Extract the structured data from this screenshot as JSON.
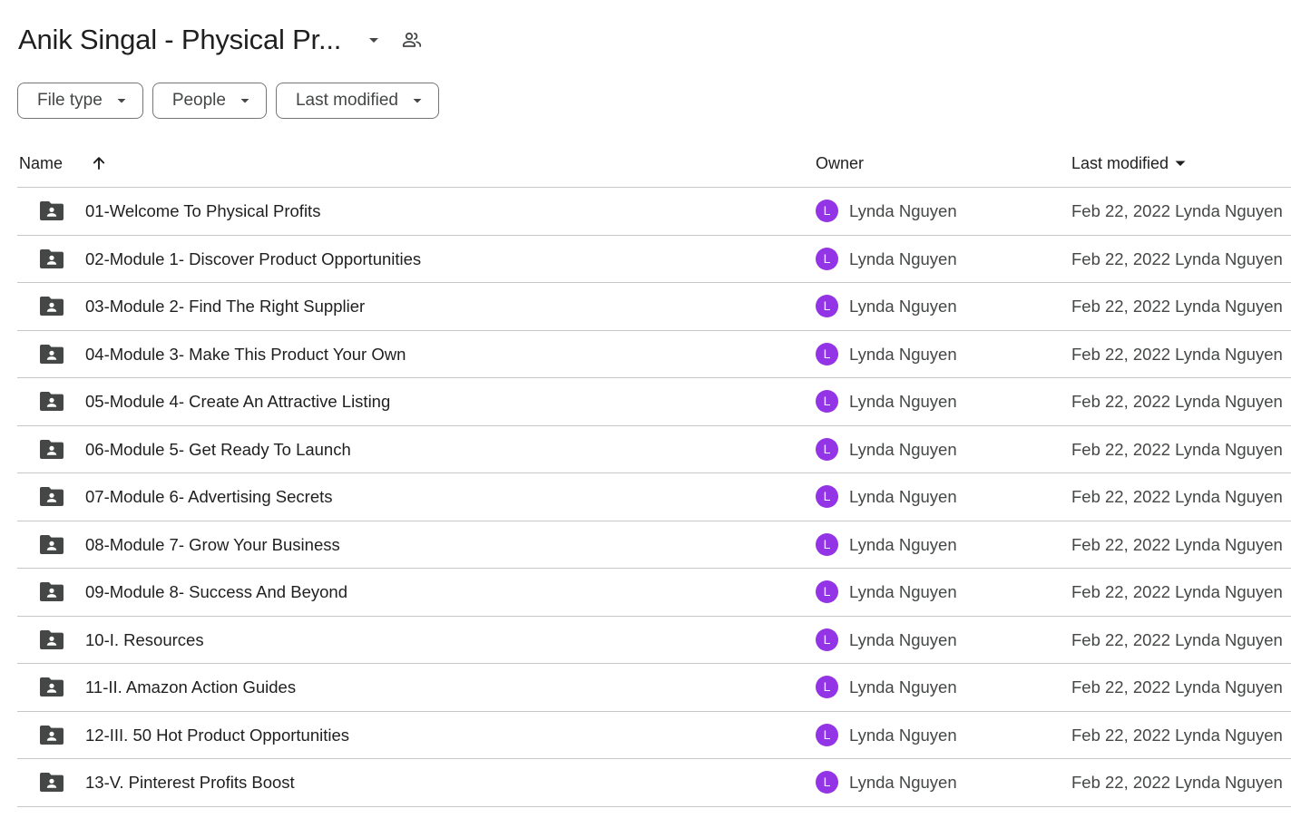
{
  "header": {
    "title": "Anik Singal - Physical Pr...",
    "title_caret_icon": "arrow-drop-down-icon",
    "share_icon": "people-icon"
  },
  "filters": [
    {
      "label": "File type",
      "icon": "arrow-drop-down-icon"
    },
    {
      "label": "People",
      "icon": "arrow-drop-down-icon"
    },
    {
      "label": "Last modified",
      "icon": "arrow-drop-down-icon"
    }
  ],
  "table": {
    "columns": {
      "name": "Name",
      "name_sort_icon": "arrow-upward-icon",
      "owner": "Owner",
      "last_modified": "Last modified",
      "last_modified_icon": "arrow-drop-down-icon"
    },
    "rows": [
      {
        "name": "01-Welcome To Physical Profits",
        "owner": "Lynda Nguyen",
        "avatar_letter": "L",
        "modified": "Feb 22, 2022 Lynda Nguyen"
      },
      {
        "name": "02-Module 1- Discover Product Opportunities",
        "owner": "Lynda Nguyen",
        "avatar_letter": "L",
        "modified": "Feb 22, 2022 Lynda Nguyen"
      },
      {
        "name": "03-Module 2- Find The Right Supplier",
        "owner": "Lynda Nguyen",
        "avatar_letter": "L",
        "modified": "Feb 22, 2022 Lynda Nguyen"
      },
      {
        "name": "04-Module 3- Make This Product Your Own",
        "owner": "Lynda Nguyen",
        "avatar_letter": "L",
        "modified": "Feb 22, 2022 Lynda Nguyen"
      },
      {
        "name": "05-Module 4- Create An Attractive Listing",
        "owner": "Lynda Nguyen",
        "avatar_letter": "L",
        "modified": "Feb 22, 2022 Lynda Nguyen"
      },
      {
        "name": "06-Module 5- Get Ready To Launch",
        "owner": "Lynda Nguyen",
        "avatar_letter": "L",
        "modified": "Feb 22, 2022 Lynda Nguyen"
      },
      {
        "name": "07-Module 6- Advertising Secrets",
        "owner": "Lynda Nguyen",
        "avatar_letter": "L",
        "modified": "Feb 22, 2022 Lynda Nguyen"
      },
      {
        "name": "08-Module 7- Grow Your Business",
        "owner": "Lynda Nguyen",
        "avatar_letter": "L",
        "modified": "Feb 22, 2022 Lynda Nguyen"
      },
      {
        "name": "09-Module 8- Success And Beyond",
        "owner": "Lynda Nguyen",
        "avatar_letter": "L",
        "modified": "Feb 22, 2022 Lynda Nguyen"
      },
      {
        "name": "10-I. Resources",
        "owner": "Lynda Nguyen",
        "avatar_letter": "L",
        "modified": "Feb 22, 2022 Lynda Nguyen"
      },
      {
        "name": "11-II. Amazon Action Guides",
        "owner": "Lynda Nguyen",
        "avatar_letter": "L",
        "modified": "Feb 22, 2022 Lynda Nguyen"
      },
      {
        "name": "12-III. 50 Hot Product Opportunities",
        "owner": "Lynda Nguyen",
        "avatar_letter": "L",
        "modified": "Feb 22, 2022 Lynda Nguyen"
      },
      {
        "name": "13-V. Pinterest Profits Boost",
        "owner": "Lynda Nguyen",
        "avatar_letter": "L",
        "modified": "Feb 22, 2022 Lynda Nguyen"
      }
    ]
  },
  "colors": {
    "avatar": "#9334e6",
    "icon": "#444746",
    "divider": "#c7c7c7"
  }
}
